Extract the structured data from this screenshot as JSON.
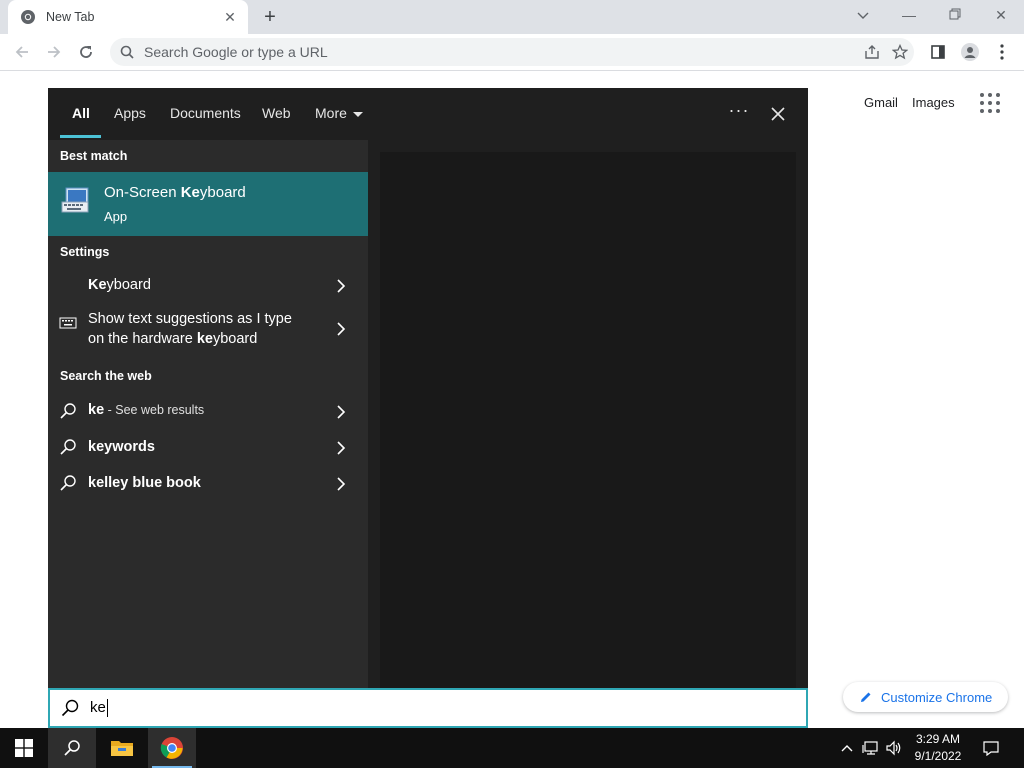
{
  "browser": {
    "tab_title": "New Tab",
    "omnibox_placeholder": "Search Google or type a URL"
  },
  "google": {
    "gmail_label": "Gmail",
    "images_label": "Images",
    "customize_label": "Customize Chrome"
  },
  "search_panel": {
    "tabs": [
      "All",
      "Apps",
      "Documents",
      "Web",
      "More"
    ],
    "active_tab": "All",
    "best_match_heading": "Best match",
    "best_match": {
      "title_pre": "On-Screen ",
      "title_bold": "Ke",
      "title_post": "yboard",
      "subtitle": "App",
      "icon": "on-screen-keyboard-icon"
    },
    "settings_heading": "Settings",
    "settings_items": [
      {
        "bold": "Ke",
        "rest": "yboard"
      },
      {
        "line1": "Show text suggestions as I type",
        "line2_pre": "on the hardware ",
        "line2_bold": "ke",
        "line2_post": "yboard"
      }
    ],
    "web_heading": "Search the web",
    "web_items": [
      {
        "bold": "ke",
        "suffix": " - See web results"
      },
      {
        "bold": "keywords"
      },
      {
        "bold": "kelley blue book"
      }
    ],
    "query": "ke"
  },
  "taskbar": {
    "time": "3:29 AM",
    "date": "9/1/2022"
  },
  "colors": {
    "accent_teal": "#1e6f74",
    "tab_underline": "#4cc2d6",
    "chrome_blue": "#1a73e8"
  }
}
